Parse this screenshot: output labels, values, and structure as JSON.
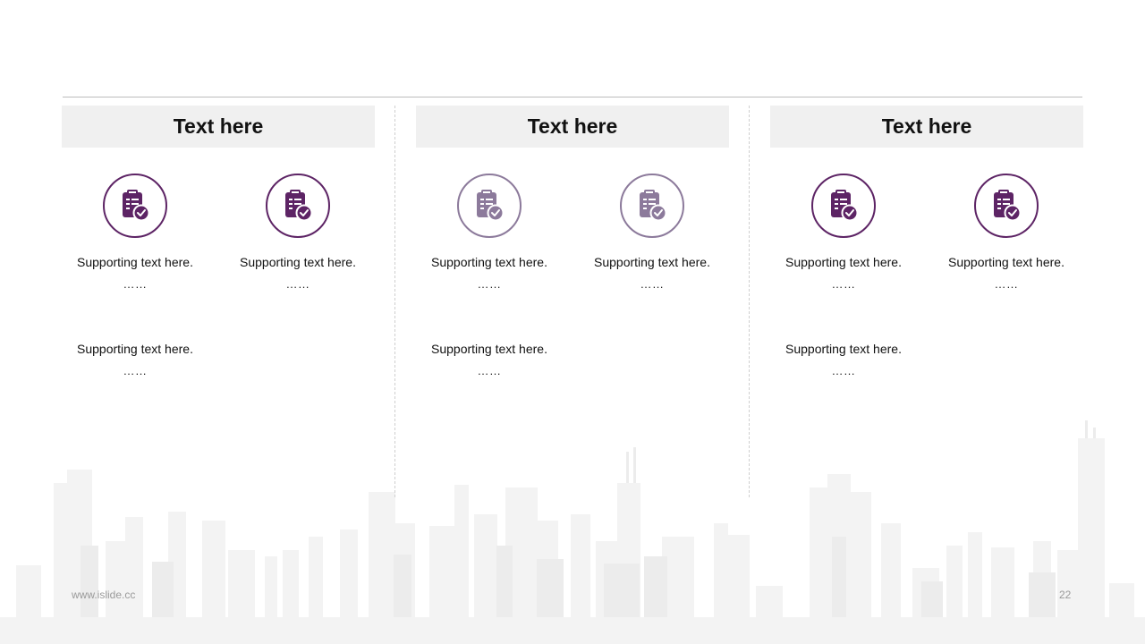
{
  "columns": [
    {
      "header": "Text here",
      "icon_color": "#5d2465",
      "items": [
        {
          "text": "Supporting  text here.",
          "dots": "……"
        },
        {
          "text": "Supporting  text here.",
          "dots": "……"
        },
        {
          "text": "Supporting  text here.",
          "dots": "……"
        }
      ]
    },
    {
      "header": "Text here",
      "icon_color": "#8c7a9b",
      "items": [
        {
          "text": "Supporting  text here.",
          "dots": "……"
        },
        {
          "text": "Supporting  text here.",
          "dots": "……"
        },
        {
          "text": "Supporting  text here.",
          "dots": "……"
        }
      ]
    },
    {
      "header": "Text here",
      "icon_color": "#5d2465",
      "items": [
        {
          "text": "Supporting  text here.",
          "dots": "……"
        },
        {
          "text": "Supporting  text here.",
          "dots": "……"
        },
        {
          "text": "Supporting  text here.",
          "dots": "……"
        }
      ]
    }
  ],
  "icons": {
    "item_icon": "clipboard-check-icon"
  },
  "footer": {
    "url": "www.islide.cc",
    "page_number": "22"
  }
}
